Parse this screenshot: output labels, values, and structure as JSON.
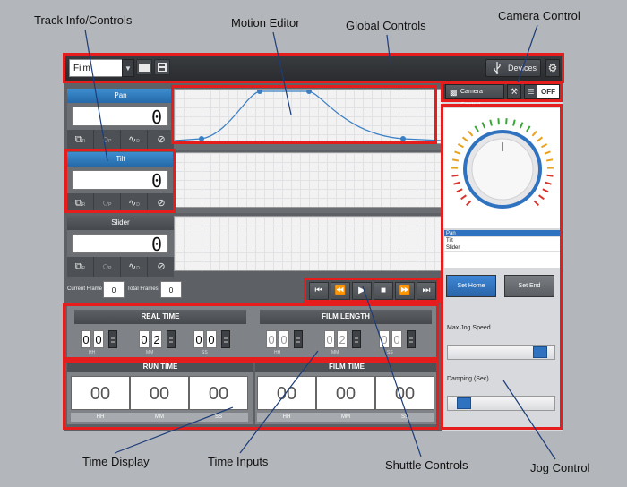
{
  "callouts": {
    "track_info": "Track Info/Controls",
    "motion_editor": "Motion Editor",
    "global_controls": "Global Controls",
    "camera_control": "Camera Control",
    "time_display": "Time Display",
    "time_inputs": "Time Inputs",
    "shuttle_controls": "Shuttle Controls",
    "jog_control": "Jog Control"
  },
  "topbar": {
    "film_select_value": "Film",
    "devices_label": "Devices"
  },
  "tracks": [
    {
      "name": "Pan",
      "value": "0",
      "tool_letters": [
        "R",
        "P",
        "D",
        ""
      ]
    },
    {
      "name": "Tilt",
      "value": "0",
      "tool_letters": [
        "R",
        "P",
        "D",
        ""
      ]
    },
    {
      "name": "Slider",
      "value": "0",
      "tool_letters": [
        "R",
        "P",
        "D",
        ""
      ]
    }
  ],
  "frames": {
    "current_label": "Current Frame",
    "current_value": "0",
    "total_label": "Total Frames",
    "total_value": "0"
  },
  "real_time": {
    "title": "REAL TIME",
    "digits": [
      "0",
      "0",
      "0",
      "2",
      "0",
      "0"
    ],
    "units": [
      "HH",
      "MM",
      "SS"
    ]
  },
  "film_length": {
    "title": "FILM LENGTH",
    "digits": [
      "0",
      "0",
      "0",
      "2",
      "0",
      "0"
    ],
    "units": [
      "HH",
      "MM",
      "SS"
    ]
  },
  "run_time": {
    "title": "RUN TIME",
    "values": [
      "00",
      "00",
      "00"
    ],
    "units": [
      "HH",
      "MM",
      "SS"
    ]
  },
  "film_time": {
    "title": "FILM TIME",
    "values": [
      "00",
      "00",
      "00"
    ],
    "units": [
      "HH",
      "MM",
      "SS"
    ]
  },
  "camera": {
    "button_label": "Camera Control",
    "toggle_label": "OFF"
  },
  "axis_list": [
    "Pan",
    "Tilt",
    "Slider"
  ],
  "jog": {
    "set_home": "Set Home",
    "set_end": "Set End",
    "max_speed_label": "Max Jog Speed",
    "max_speed_level": 0.92,
    "damping_label": "Damping (Sec)",
    "damping_level": 0.1
  },
  "colors": {
    "accent_blue": "#2f72c0",
    "highlight_red": "#e51d1d",
    "curve_blue": "#3a7fc4"
  },
  "icons": {
    "open": "folder-icon",
    "save": "floppy-icon",
    "devices": "usb-icon",
    "settings": "gear-icon"
  }
}
